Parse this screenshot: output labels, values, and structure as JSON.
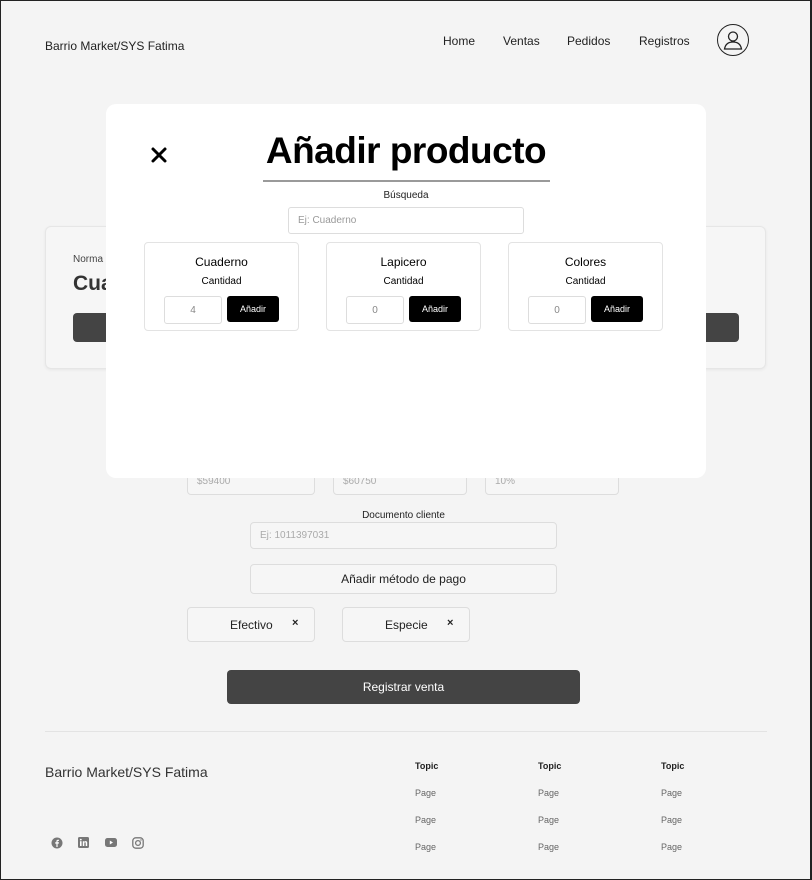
{
  "header": {
    "brand": "Barrio Market/SYS Fatima",
    "nav": [
      "Home",
      "Ventas",
      "Pedidos",
      "Registros"
    ]
  },
  "background_card": {
    "label": "Norma",
    "title": "Cua"
  },
  "form": {
    "totals": [
      "$59400",
      "$60750",
      "10%"
    ],
    "document_label": "Documento cliente",
    "document_placeholder": "Ej: 1011397031",
    "add_payment_label": "Añadir método de pago",
    "payment_methods": [
      {
        "label": "Efectivo",
        "remove": "×"
      },
      {
        "label": "Especie",
        "remove": "×"
      }
    ],
    "register_label": "Registrar venta"
  },
  "footer": {
    "brand": "Barrio Market/SYS Fatima",
    "columns": [
      {
        "topic": "Topic",
        "pages": [
          "Page",
          "Page",
          "Page"
        ]
      },
      {
        "topic": "Topic",
        "pages": [
          "Page",
          "Page",
          "Page"
        ]
      },
      {
        "topic": "Topic",
        "pages": [
          "Page",
          "Page",
          "Page"
        ]
      }
    ],
    "social_icons": [
      "facebook-icon",
      "linkedin-icon",
      "youtube-icon",
      "instagram-icon"
    ]
  },
  "modal": {
    "title": "Añadir producto",
    "close": "×",
    "search_label": "Búsqueda",
    "search_placeholder": "Ej: Cuaderno",
    "products": [
      {
        "name": "Cuaderno",
        "qty_label": "Cantidad",
        "qty": "4",
        "button": "Añadir"
      },
      {
        "name": "Lapicero",
        "qty_label": "Cantidad",
        "qty": "0",
        "button": "Añadir"
      },
      {
        "name": "Colores",
        "qty_label": "Cantidad",
        "qty": "0",
        "button": "Añadir"
      }
    ]
  },
  "colors": {
    "page_bg": "#f4f4f4",
    "dark_button": "#444444",
    "modal_button": "#000000",
    "modal_bg": "#ffffff"
  }
}
